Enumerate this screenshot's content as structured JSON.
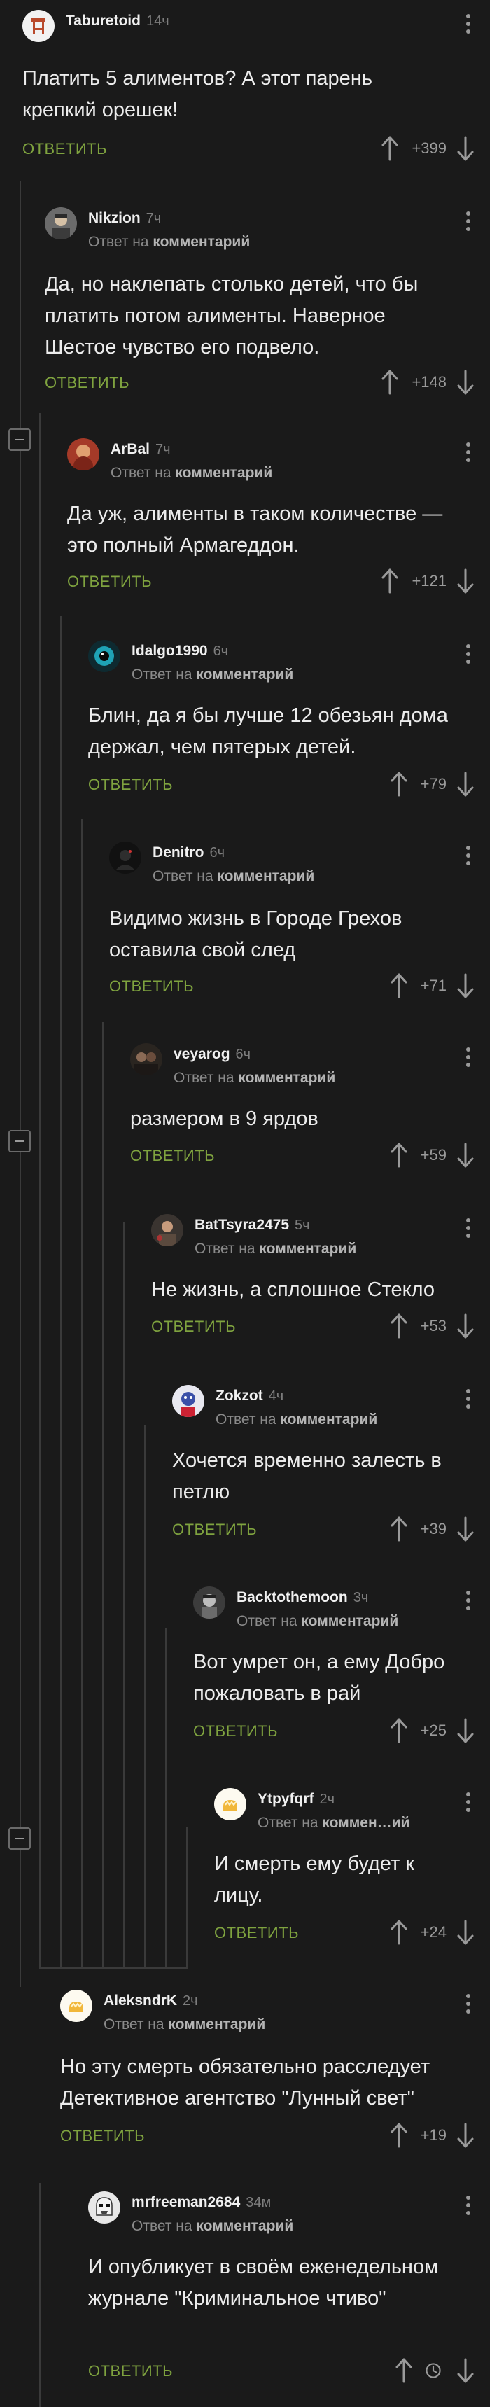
{
  "labels": {
    "reply": "ОТВЕТИТЬ",
    "reply_to_prefix": "Ответ на ",
    "reply_to_target": "комментарий",
    "reply_to_target_short": "коммен…ий"
  },
  "comments": [
    {
      "author": "Taburetoid",
      "time": "14ч",
      "text": "Платить 5 алиментов? А этот парень крепкий орешек!",
      "rating": "+399",
      "avatar": "stool-avatar"
    },
    {
      "author": "Nikzion",
      "time": "7ч",
      "text": "Да, но наклепать столько детей, что бы платить потом алименты. Наверное Шестое чувство его подвело.",
      "rating": "+148",
      "avatar": "man-avatar"
    },
    {
      "author": "ArBal",
      "time": "7ч",
      "text": "Да уж, алименты в таком количестве — это полный Армагеддон.",
      "rating": "+121",
      "avatar": "red-avatar"
    },
    {
      "author": "Idalgo1990",
      "time": "6ч",
      "text": "Блин, да я бы лучше 12 обезьян дома держал, чем пятерых детей.",
      "rating": "+79",
      "avatar": "eye-avatar"
    },
    {
      "author": "Denitro",
      "time": "6ч",
      "text": "Видимо жизнь в Городе Грехов оставила свой след",
      "rating": "+71",
      "avatar": "dark-avatar"
    },
    {
      "author": "veyarog",
      "time": "6ч",
      "text": "размером в 9 ярдов",
      "rating": "+59",
      "avatar": "couple-avatar"
    },
    {
      "author": "BatTsyra2475",
      "time": "5ч",
      "text": "Не жизнь, а сплошное Стекло",
      "rating": "+53",
      "avatar": "person-avatar"
    },
    {
      "author": "Zokzot",
      "time": "4ч",
      "text": "Хочется временно залесть в петлю",
      "rating": "+39",
      "avatar": "cartoon-avatar"
    },
    {
      "author": "Backtothemoon",
      "time": "3ч",
      "text": "Вот умрет он, а ему Добро пожаловать в рай",
      "rating": "+25",
      "avatar": "moon-avatar"
    },
    {
      "author": "Ytpyfqrf",
      "time": "2ч",
      "text": "И смерть ему будет к лицу.",
      "rating": "+24",
      "avatar": "default-avatar"
    },
    {
      "author": "AleksndrK",
      "time": "2ч",
      "text": "Но эту смерть обязательно расследует Детективное агентство \"Лунный свет\"",
      "rating": "+19",
      "avatar": "default-avatar"
    },
    {
      "author": "mrfreeman2684",
      "time": "34м",
      "text": "И опубликует в своём еженедельном журнале \"Криминальное чтиво\"",
      "rating": "",
      "avatar": "trooper-avatar"
    }
  ]
}
